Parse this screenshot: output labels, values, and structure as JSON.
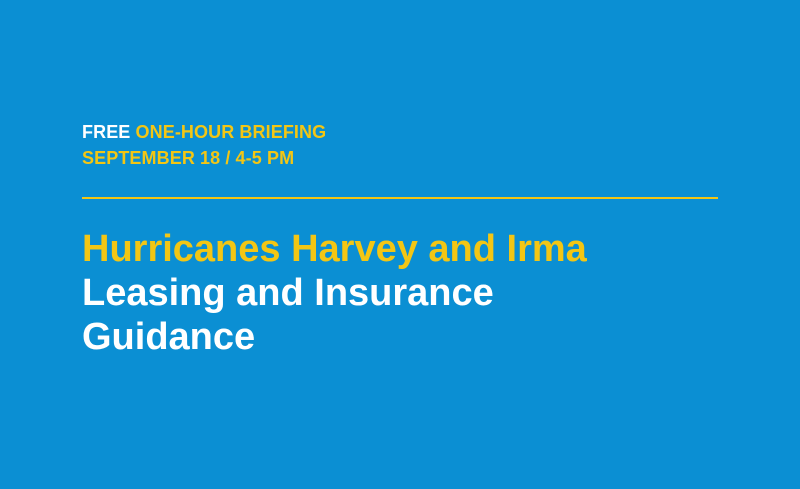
{
  "briefing": {
    "free_label": "FREE",
    "type_label": "ONE-HOUR BRIEFING",
    "date_time": "SEPTEMBER 18 / 4-5 PM"
  },
  "headline": {
    "line1": "Hurricanes Harvey and Irma",
    "line2": "Leasing and Insurance",
    "line3": "Guidance"
  },
  "colors": {
    "background": "#0b8fd3",
    "accent": "#f3c614",
    "text": "#ffffff"
  }
}
